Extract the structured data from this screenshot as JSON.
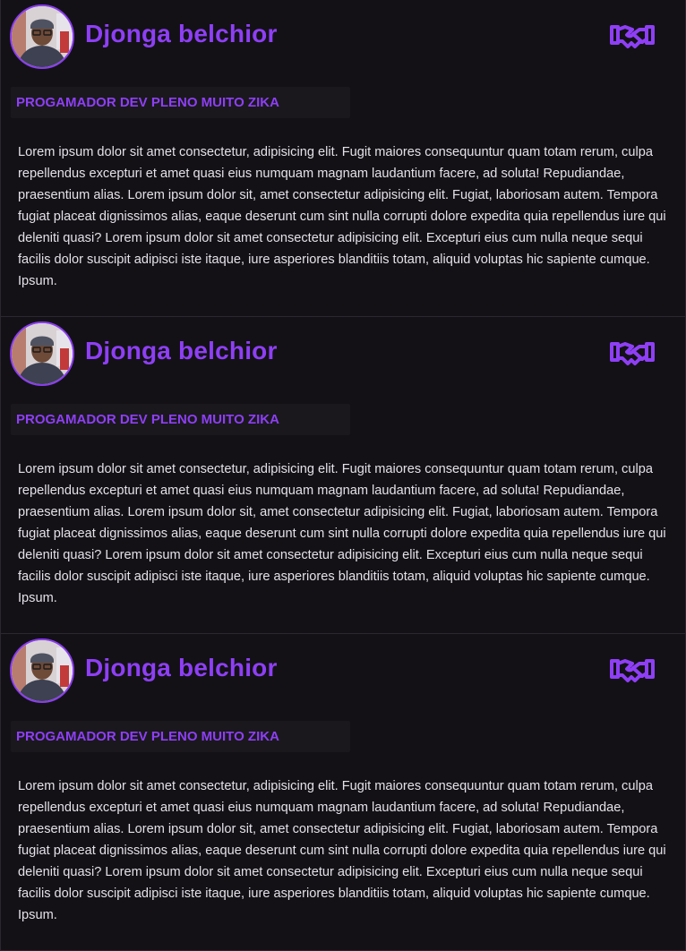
{
  "colors": {
    "accent": "#8e3ff5",
    "background": "#121014",
    "tag_background": "#1a181d",
    "text": "#e4e2e8"
  },
  "posts": [
    {
      "name": "Djonga belchior",
      "tag": "PROGAMADOR DEV PLENO MUITO ZIKA",
      "bio": "Lorem ipsum dolor sit amet consectetur, adipisicing elit. Fugit maiores consequuntur quam totam rerum, culpa repellendus excepturi et amet quasi eius numquam magnam laudantium facere, ad soluta! Repudiandae, praesentium alias. Lorem ipsum dolor sit, amet consectetur adipisicing elit. Fugiat, laboriosam autem. Tempora fugiat placeat dignissimos alias, eaque deserunt cum sint nulla corrupti dolore expedita quia repellendus iure qui deleniti quasi? Lorem ipsum dolor sit amet consectetur adipisicing elit. Excepturi eius cum nulla neque sequi facilis dolor suscipit adipisci iste itaque, iure asperiores blanditiis totam, aliquid voluptas hic sapiente cumque. Ipsum.",
      "icon": "handshake-icon"
    },
    {
      "name": "Djonga belchior",
      "tag": "PROGAMADOR DEV PLENO MUITO ZIKA",
      "bio": "Lorem ipsum dolor sit amet consectetur, adipisicing elit. Fugit maiores consequuntur quam totam rerum, culpa repellendus excepturi et amet quasi eius numquam magnam laudantium facere, ad soluta! Repudiandae, praesentium alias. Lorem ipsum dolor sit, amet consectetur adipisicing elit. Fugiat, laboriosam autem. Tempora fugiat placeat dignissimos alias, eaque deserunt cum sint nulla corrupti dolore expedita quia repellendus iure qui deleniti quasi? Lorem ipsum dolor sit amet consectetur adipisicing elit. Excepturi eius cum nulla neque sequi facilis dolor suscipit adipisci iste itaque, iure asperiores blanditiis totam, aliquid voluptas hic sapiente cumque. Ipsum.",
      "icon": "handshake-icon"
    },
    {
      "name": "Djonga belchior",
      "tag": "PROGAMADOR DEV PLENO MUITO ZIKA",
      "bio": "Lorem ipsum dolor sit amet consectetur, adipisicing elit. Fugit maiores consequuntur quam totam rerum, culpa repellendus excepturi et amet quasi eius numquam magnam laudantium facere, ad soluta! Repudiandae, praesentium alias. Lorem ipsum dolor sit, amet consectetur adipisicing elit. Fugiat, laboriosam autem. Tempora fugiat placeat dignissimos alias, eaque deserunt cum sint nulla corrupti dolore expedita quia repellendus iure qui deleniti quasi? Lorem ipsum dolor sit amet consectetur adipisicing elit. Excepturi eius cum nulla neque sequi facilis dolor suscipit adipisci iste itaque, iure asperiores blanditiis totam, aliquid voluptas hic sapiente cumque. Ipsum.",
      "icon": "handshake-icon"
    }
  ]
}
